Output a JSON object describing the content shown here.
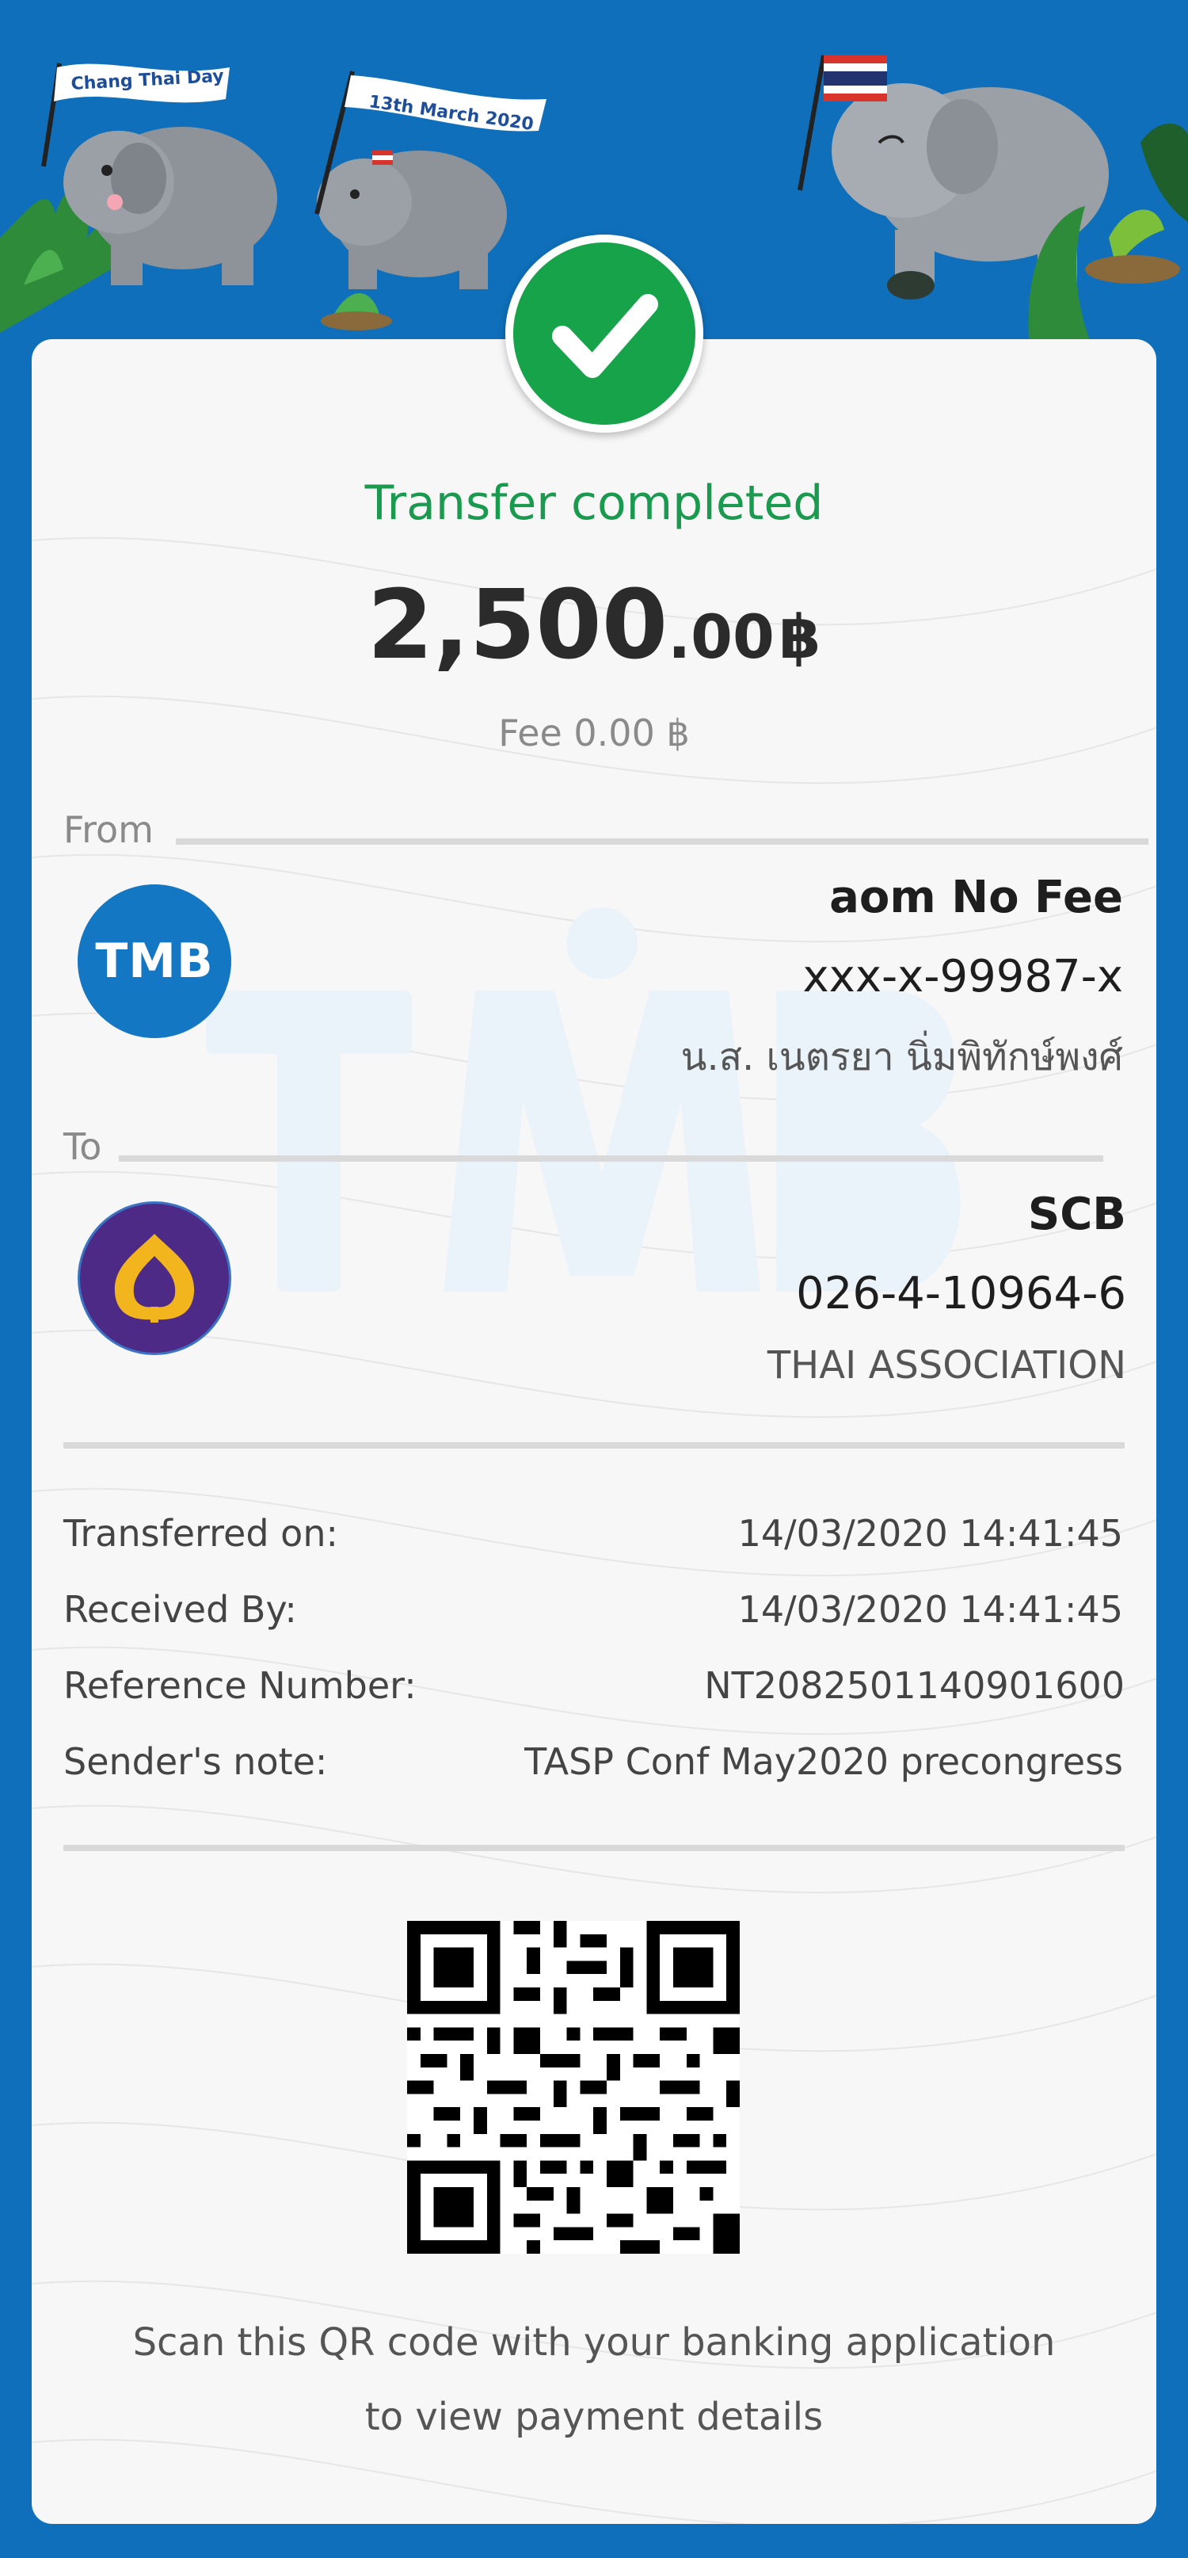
{
  "banner": {
    "flag_left_text": "Chang Thai Day",
    "flag_right_text": "13th March 2020"
  },
  "status": {
    "title": "Transfer completed",
    "amount_int": "2,500",
    "amount_dec": ".00",
    "currency": "฿",
    "fee": "Fee 0.00 ฿"
  },
  "from": {
    "label": "From",
    "bank_logo_text": "TMB",
    "name": "aom No Fee",
    "account": "xxx-x-99987-x",
    "owner": "น.ส. เนตรยา นิ่มพิทักษ์พงศ์"
  },
  "to": {
    "label": "To",
    "bank": "SCB",
    "account": "026-4-10964-6",
    "owner": "THAI ASSOCIATION"
  },
  "details": [
    {
      "label": "Transferred on:",
      "value": "14/03/2020 14:41:45"
    },
    {
      "label": "Received By:",
      "value": "14/03/2020 14:41:45"
    },
    {
      "label": "Reference Number:",
      "value": "NT2082501140901600"
    },
    {
      "label": "Sender's note:",
      "value": "TASP Conf May2020 precongress"
    }
  ],
  "qr": {
    "caption_line1": "Scan this QR code with your banking application",
    "caption_line2": "to view payment details"
  },
  "colors": {
    "background": "#0f6fba",
    "success": "#1a9a4f",
    "tmb_blue": "#1377c4",
    "scb_purple": "#4c2a85",
    "scb_gold": "#f2b51d"
  }
}
